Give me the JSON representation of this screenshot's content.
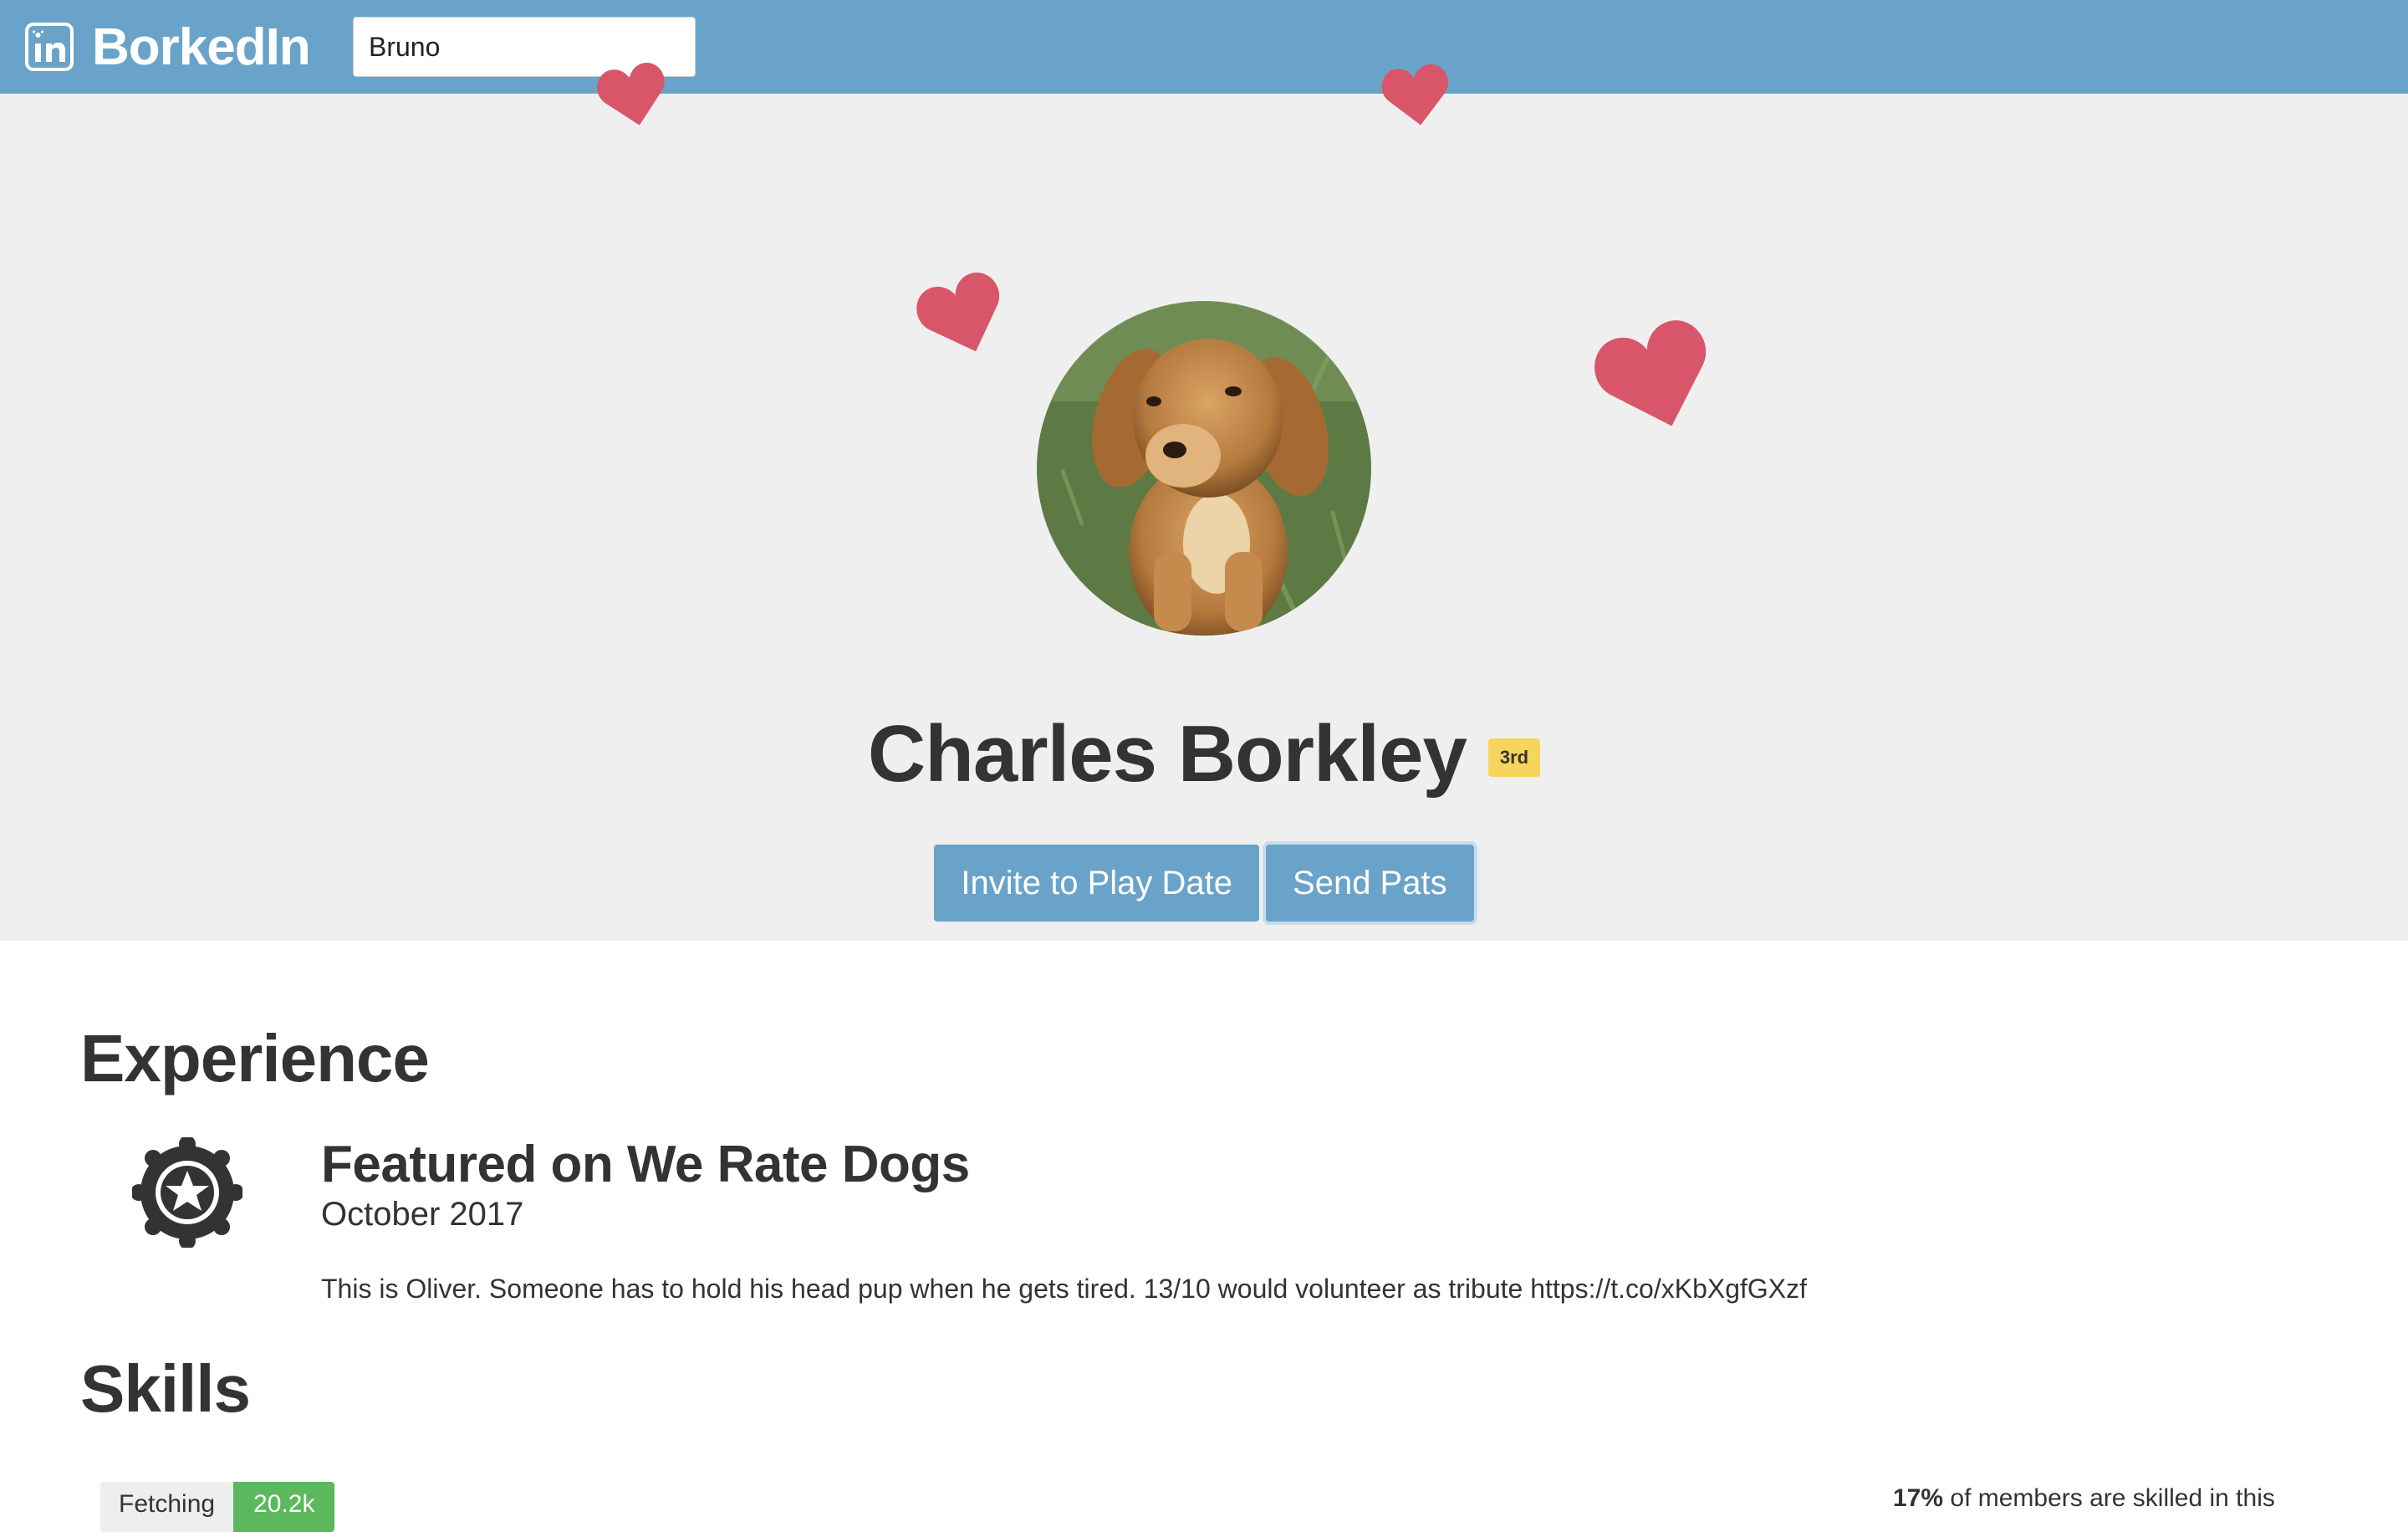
{
  "app": {
    "brand_name": "BorkedIn",
    "brand_icon": "linkedin-paw-icon",
    "colors": {
      "header": "#6aa3c9",
      "hero_background": "#efefef",
      "button": "#6aa3c9",
      "badge": "#f7d45c",
      "heart": "#d9566a",
      "skill_count": "#5cb85c"
    }
  },
  "search": {
    "value": "Bruno"
  },
  "profile": {
    "name": "Charles Borkley",
    "connection_degree": "3rd",
    "actions": {
      "invite_label": "Invite to Play Date",
      "pats_label": "Send Pats"
    }
  },
  "experience": {
    "title": "Experience",
    "items": [
      {
        "icon": "award-badge-icon",
        "heading": "Featured on We Rate Dogs",
        "date": "October 2017",
        "description": "This is Oliver. Someone has to hold his head pup when he gets tired. 13/10 would volunteer as tribute https://t.co/xKbXgfGXzf"
      }
    ]
  },
  "skills": {
    "title": "Skills",
    "items": [
      {
        "name": "Fetching",
        "count": "20.2k"
      }
    ],
    "stat_percent": "17%",
    "stat_text": " of members are skilled in this"
  }
}
